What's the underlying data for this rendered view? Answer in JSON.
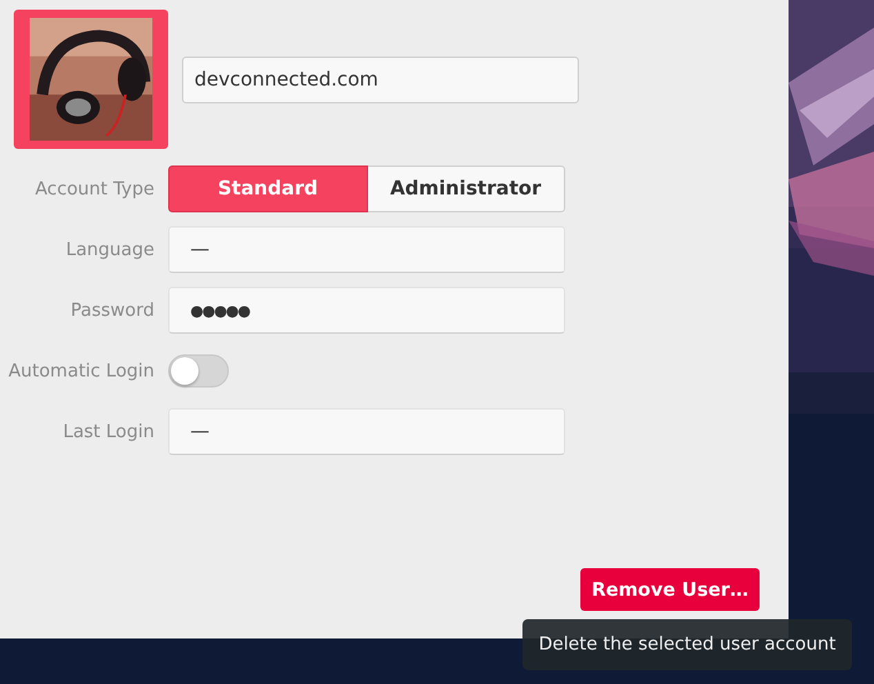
{
  "user": {
    "avatar": {
      "selected": true
    },
    "name": "devconnected.com"
  },
  "account_type": {
    "label": "Account Type",
    "options": [
      {
        "label": "Standard",
        "selected": true
      },
      {
        "label": "Administrator",
        "selected": false
      }
    ]
  },
  "fields": [
    {
      "kind": "text",
      "label": "Language",
      "value": "—"
    },
    {
      "kind": "password",
      "label": "Password",
      "value": "●●●●●"
    },
    {
      "kind": "toggle",
      "label": "Automatic Login",
      "on": false
    },
    {
      "kind": "text",
      "label": "Last Login",
      "value": "—"
    }
  ],
  "remove_button": "Remove User…",
  "tooltip": "Delete the selected user account"
}
